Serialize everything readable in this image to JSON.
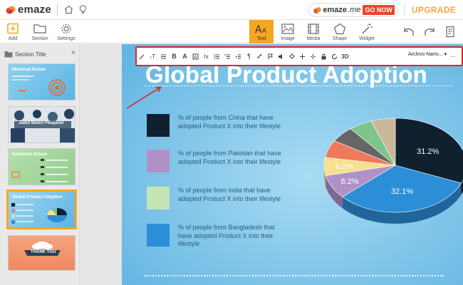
{
  "app": {
    "logo_text": "emaze",
    "emazeme_text": "emaze",
    "emazeme_suffix": ".me",
    "go_now": "GO NOW",
    "upgrade": "UPGRADE"
  },
  "toolbar_left": [
    {
      "label": "Add",
      "icon": "plus-square-icon"
    },
    {
      "label": "Section",
      "icon": "folder-icon"
    },
    {
      "label": "Settings",
      "icon": "gear-icon"
    }
  ],
  "toolbar_center": [
    {
      "label": "Text",
      "icon": "text-aa-icon",
      "active": true
    },
    {
      "label": "Image",
      "icon": "image-icon"
    },
    {
      "label": "Media",
      "icon": "film-icon"
    },
    {
      "label": "Shape",
      "icon": "pentagon-icon"
    },
    {
      "label": "Widget",
      "icon": "magic-wand-icon"
    }
  ],
  "toolbar_right": [
    {
      "icon": "undo-icon"
    },
    {
      "icon": "redo-icon"
    },
    {
      "icon": "notes-icon"
    }
  ],
  "sidebar": {
    "section_title": "Section Title",
    "close": "×",
    "slides": [
      {
        "title": "Membuat Emaze",
        "selected": false
      },
      {
        "title": "Judul Materi Pelajaran",
        "selected": false
      },
      {
        "title": "Kelebihan Emaze",
        "selected": false
      },
      {
        "title": "Global Product Adoption",
        "selected": true
      },
      {
        "title": "THANK YOU",
        "selected": false
      }
    ],
    "collapse": "«"
  },
  "format_toolbar": {
    "font_name": "Archivo Narro...",
    "dropdown_caret": "▾",
    "more": "...",
    "three_d_label": "3D"
  },
  "slide": {
    "title": "Global Product Adoption",
    "legend": [
      {
        "text": "% of people from China that have adopted Product X into their lifestyle",
        "color": "#10202e"
      },
      {
        "text": "% of people from Pakistan that have adopted Product X into their lifestyle",
        "color": "#b190c8"
      },
      {
        "text": "% of people from India that have adopted Product X into their lifestyle",
        "color": "#c6e5b6"
      },
      {
        "text": "% of people from Bangladesh that have adopted Product X into their lifestyle",
        "color": "#2c8ed6"
      }
    ]
  },
  "chart_data": {
    "type": "pie",
    "title": "",
    "slices": [
      {
        "value": 31.2,
        "label": "31.2%",
        "color": "#10202e"
      },
      {
        "value": 32.1,
        "label": "32.1%",
        "color": "#2c8ed6"
      },
      {
        "value": 8.2,
        "label": "8.2%",
        "color": "#b190c8"
      },
      {
        "value": 6.2,
        "label": "6.2%",
        "color": "#f7e08e"
      },
      {
        "value": 6.0,
        "label": "",
        "color": "#ee7a5c"
      },
      {
        "value": 5.5,
        "label": "",
        "color": "#666666"
      },
      {
        "value": 5.3,
        "label": "",
        "color": "#7fc48a"
      },
      {
        "value": 5.5,
        "label": "",
        "color": "#c9b99a"
      }
    ]
  }
}
